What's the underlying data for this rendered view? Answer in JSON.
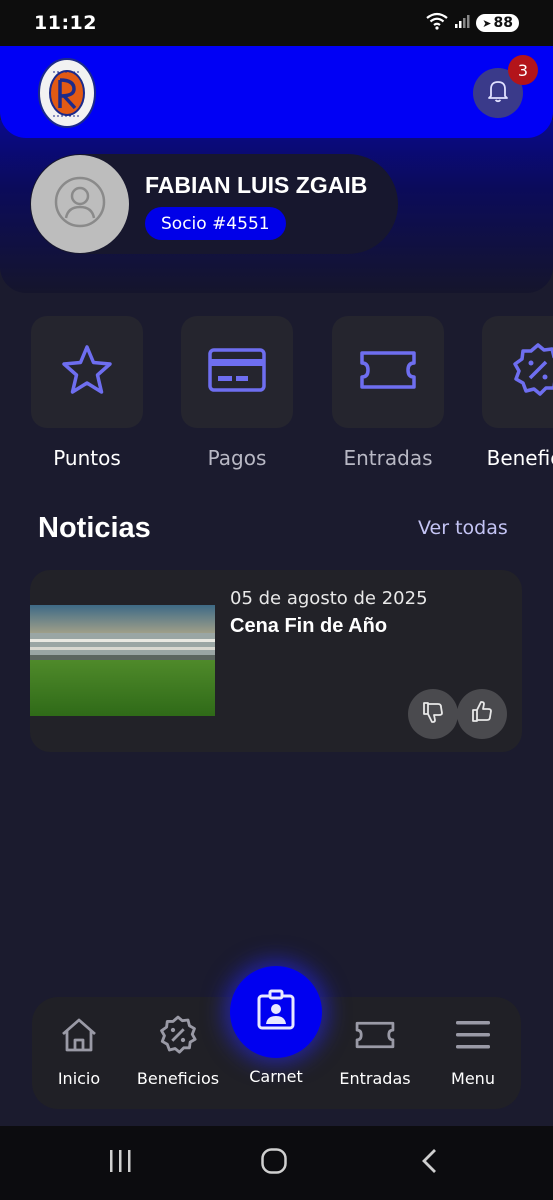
{
  "status_bar": {
    "time": "11:12",
    "battery": "88"
  },
  "header": {
    "logo_icon": "club-crest-logo",
    "notification_icon": "bell-icon",
    "notification_count": "3"
  },
  "profile": {
    "name": "FABIAN LUIS ZGAIB",
    "member_label": "Socio #4551",
    "avatar_icon": "user-avatar-icon"
  },
  "quick_actions": [
    {
      "label": "Puntos",
      "icon": "star-icon"
    },
    {
      "label": "Pagos",
      "icon": "credit-card-icon"
    },
    {
      "label": "Entradas",
      "icon": "ticket-icon"
    },
    {
      "label": "Beneficios",
      "icon": "discount-badge-icon"
    }
  ],
  "news": {
    "title": "Noticias",
    "see_all": "Ver todas",
    "items": [
      {
        "date": "05 de agosto de 2025",
        "headline": "Cena Fin de Año",
        "image": "stadium-photo"
      }
    ]
  },
  "bottom_nav": {
    "items": [
      {
        "label": "Inicio",
        "icon": "home-icon"
      },
      {
        "label": "Beneficios",
        "icon": "discount-badge-icon"
      },
      {
        "label": "Carnet",
        "icon": "id-card-icon"
      },
      {
        "label": "Entradas",
        "icon": "ticket-icon"
      },
      {
        "label": "Menu",
        "icon": "hamburger-icon"
      }
    ]
  },
  "colors": {
    "accent": "#0000f5",
    "background": "#1b1b2e",
    "tile": "#25252e",
    "icon_purple": "#6e6ef0",
    "badge": "#b3141a"
  }
}
